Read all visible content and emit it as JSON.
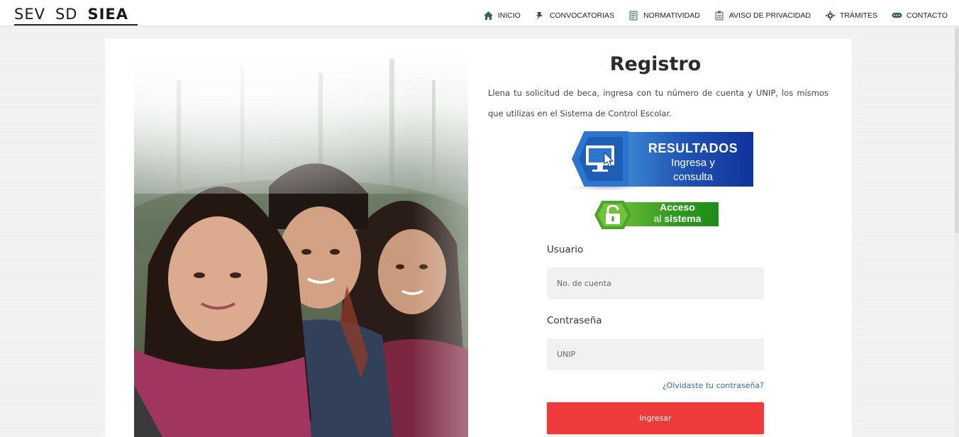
{
  "header": {
    "logo": {
      "part1": "SEV",
      "part2": "SD",
      "part3": "SIEA"
    },
    "nav": [
      {
        "label": "INICIO",
        "icon": "home-icon"
      },
      {
        "label": "CONVOCATORIAS",
        "icon": "pin-icon"
      },
      {
        "label": "NORMATIVIDAD",
        "icon": "document-icon"
      },
      {
        "label": "AVISO DE PRIVACIDAD",
        "icon": "clipboard-icon"
      },
      {
        "label": "TRÁMITES",
        "icon": "cog-icon"
      },
      {
        "label": "CONTACTO",
        "icon": "chat-icon"
      }
    ]
  },
  "main": {
    "title": "Registro",
    "intro": "Llena tu solicitud de beca, ingresa con tu número de cuenta y UNIP, los mismos que utilizas en el Sistema de Control Escolar.",
    "photo_alt": "three-students-photo",
    "results_banner": {
      "title": "RESULTADOS",
      "line1": "Ingresa y",
      "line2": "consulta",
      "color": "#1f56b5"
    },
    "access_banner": {
      "line1": "Acceso",
      "line2_a": "al ",
      "line2_b": "sistema",
      "color": "#2f9a1f"
    },
    "form": {
      "user_label": "Usuario",
      "user_placeholder": "No. de cuenta",
      "password_label": "Contraseña",
      "password_placeholder": "UNIP",
      "forgot_link": "¿Olvidaste tu contraseña?",
      "submit_label": "Ingresar",
      "submit_color": "#ee3a3a"
    }
  }
}
